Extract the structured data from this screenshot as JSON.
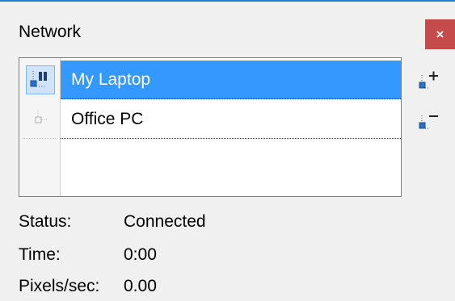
{
  "window": {
    "title": "Network",
    "close_label": "×"
  },
  "computers": [
    {
      "name": "My Laptop",
      "selected": true,
      "icon": "computer-active-icon"
    },
    {
      "name": "Office PC",
      "selected": false,
      "icon": "computer-inactive-icon"
    }
  ],
  "side_buttons": {
    "add_icon": "add-computer-icon",
    "remove_icon": "remove-computer-icon"
  },
  "status": {
    "status_label": "Status:",
    "status_value": "Connected",
    "time_label": "Time:",
    "time_value": "0:00",
    "pixels_label": "Pixels/sec:",
    "pixels_value": "0.00"
  },
  "colors": {
    "selection": "#3399ff",
    "close": "#c54a4a",
    "accent_line": "#1e7fd6"
  }
}
